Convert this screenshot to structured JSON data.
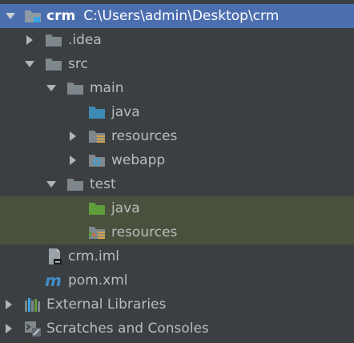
{
  "tree": {
    "root": {
      "name": "crm",
      "path": "C:\\Users\\admin\\Desktop\\crm"
    },
    "idea": ".idea",
    "src": "src",
    "main": "main",
    "main_java": "java",
    "main_resources": "resources",
    "webapp": "webapp",
    "test": "test",
    "test_java": "java",
    "test_resources": "resources",
    "crm_iml": "crm.iml",
    "pom_xml": "pom.xml",
    "external_libraries": "External Libraries",
    "scratches": "Scratches and Consoles"
  },
  "colors": {
    "background": "#3c3f41",
    "selection": "#4b6eaf",
    "test_highlight": "#49513e",
    "folder_gray": "#7e878c",
    "source_blue": "#3d8ab5",
    "test_green": "#5e9c3c",
    "maven_blue": "#3f8ec8"
  },
  "icons": [
    "chevron-down-icon",
    "chevron-right-icon",
    "module-folder-icon",
    "folder-icon",
    "source-folder-icon",
    "resources-folder-icon",
    "web-folder-icon",
    "test-folder-icon",
    "test-resources-folder-icon",
    "iml-file-icon",
    "maven-icon",
    "libraries-icon",
    "scratches-icon"
  ]
}
